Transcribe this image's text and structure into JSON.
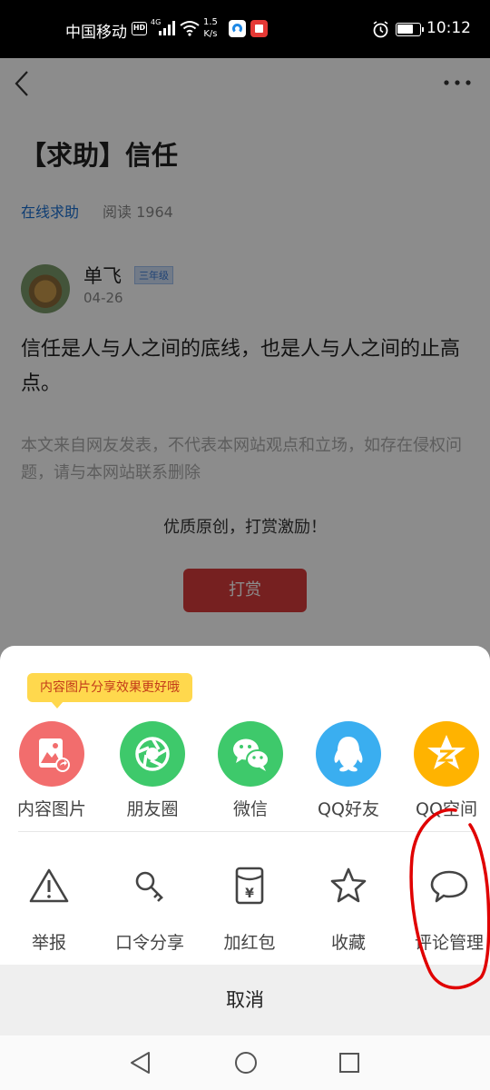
{
  "status_bar": {
    "carrier": "中国移动",
    "hd": "HD",
    "network": "4G",
    "speed_value": "1.5",
    "speed_unit": "K/s",
    "time": "10:12"
  },
  "article": {
    "title": "【求助】信任",
    "category": "在线求助",
    "reads": "阅读 1964",
    "author": "单飞",
    "grade": "三年级",
    "date": "04-26",
    "body": "信任是人与人之间的底线，也是人与人之间的止高点。",
    "disclaimer": "本文来自网友发表，不代表本网站观点和立场，如存在侵权问题，请与本网站联系删除",
    "encourage": "优质原创，打赏激励！",
    "reward_label": "打赏"
  },
  "share_sheet": {
    "tip": "内容图片分享效果更好哦",
    "share_items": [
      {
        "label": "内容图片",
        "icon": "image-share-icon",
        "color": "#f06a6a"
      },
      {
        "label": "朋友圈",
        "icon": "moments-icon",
        "color": "#3ec96b"
      },
      {
        "label": "微信",
        "icon": "wechat-icon",
        "color": "#3ec96b"
      },
      {
        "label": "QQ好友",
        "icon": "qq-icon",
        "color": "#3aaef0"
      },
      {
        "label": "QQ空间",
        "icon": "qzone-icon",
        "color": "#ffb300"
      }
    ],
    "actions": [
      {
        "label": "举报",
        "icon": "warning-icon"
      },
      {
        "label": "口令分享",
        "icon": "key-icon"
      },
      {
        "label": "加红包",
        "icon": "red-packet-icon"
      },
      {
        "label": "收藏",
        "icon": "star-icon"
      },
      {
        "label": "评论管理",
        "icon": "comment-icon"
      }
    ],
    "cancel_label": "取消"
  }
}
